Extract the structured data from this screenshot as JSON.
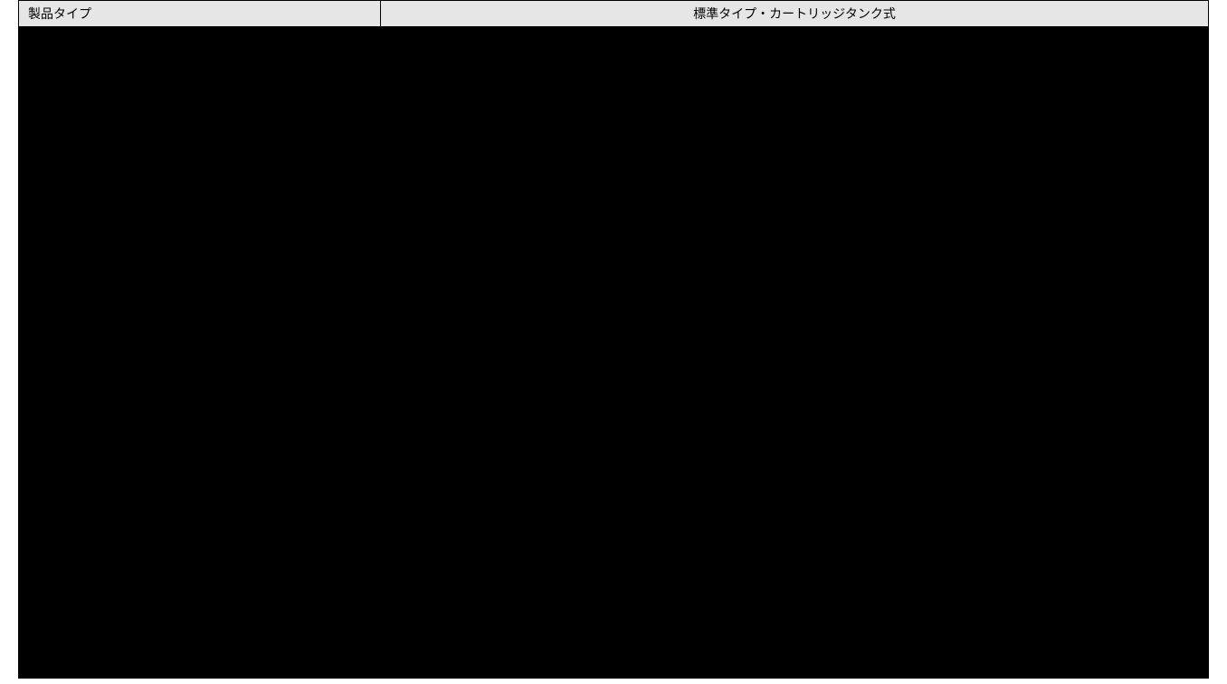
{
  "table": {
    "header": {
      "label": "製品タイプ",
      "value": "標準タイプ・カートリッジタンク式"
    }
  }
}
